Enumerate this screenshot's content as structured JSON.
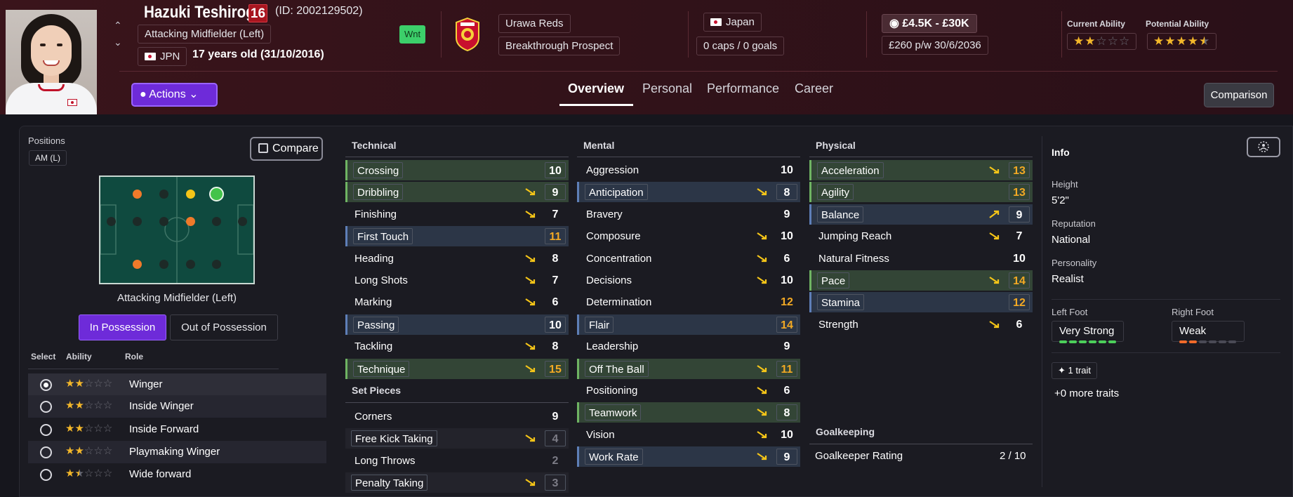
{
  "colors": {
    "accent": "#6e2bd9",
    "orange": "#f3a924",
    "green": "#6fb463",
    "blue": "#5e7fb8",
    "star": "#f3b72a",
    "star_empty": "#6b6b74"
  },
  "header": {
    "name": "Hazuki Teshirogi",
    "squad_number": "16",
    "id_text": "(ID: 2002129502)",
    "position": "Attacking Midfielder (Left)",
    "nationality_code": "JPN",
    "age_text": "17 years old (31/10/2016)",
    "wnt_badge": "Wnt",
    "club": "Urawa Reds",
    "status": "Breakthrough Prospect",
    "country": "Japan",
    "caps": "0 caps / 0 goals",
    "value": "£4.5K - £30K",
    "wage": "£260 p/w 30/6/2036",
    "current_ability_label": "Current Ability",
    "potential_ability_label": "Potential Ability",
    "current_ability_stars": 2,
    "potential_ability_stars": 4.5
  },
  "toolbar": {
    "actions_label": "Actions",
    "comparison_label": "Comparison"
  },
  "tabs": [
    {
      "label": "Overview",
      "active": true
    },
    {
      "label": "Personal"
    },
    {
      "label": "Performance"
    },
    {
      "label": "Career"
    }
  ],
  "left": {
    "positions_label": "Positions",
    "position_tag": "AM (L)",
    "compare_label": "Compare",
    "position_name": "Attacking Midfielder (Left)",
    "in_possession": "In Possession",
    "out_of_possession": "Out of Possession",
    "headers": {
      "select": "Select",
      "ability": "Ability",
      "role": "Role"
    },
    "roles": [
      {
        "name": "Winger",
        "stars": 2,
        "selected": true
      },
      {
        "name": "Inside Winger",
        "stars": 2
      },
      {
        "name": "Inside Forward",
        "stars": 2
      },
      {
        "name": "Playmaking Winger",
        "stars": 2
      },
      {
        "name": "Wide forward",
        "stars": 1.5
      }
    ]
  },
  "technical": {
    "title": "Technical",
    "attrs": [
      {
        "name": "Crossing",
        "value": "10",
        "hl": "green"
      },
      {
        "name": "Dribbling",
        "value": "9",
        "hl": "green",
        "trend": "down"
      },
      {
        "name": "Finishing",
        "value": "7",
        "trend": "down"
      },
      {
        "name": "First Touch",
        "value": "11",
        "hl": "blue",
        "color": "orange"
      },
      {
        "name": "Heading",
        "value": "8",
        "trend": "down"
      },
      {
        "name": "Long Shots",
        "value": "7",
        "trend": "down"
      },
      {
        "name": "Marking",
        "value": "6",
        "trend": "down"
      },
      {
        "name": "Passing",
        "value": "10",
        "hl": "blue"
      },
      {
        "name": "Tackling",
        "value": "8",
        "trend": "down"
      },
      {
        "name": "Technique",
        "value": "15",
        "hl": "green",
        "trend": "down",
        "color": "orange"
      }
    ]
  },
  "set_pieces": {
    "title": "Set Pieces",
    "attrs": [
      {
        "name": "Corners",
        "value": "9"
      },
      {
        "name": "Free Kick Taking",
        "value": "4",
        "hl": "grey",
        "trend": "down",
        "color": "dim"
      },
      {
        "name": "Long Throws",
        "value": "2",
        "color": "dim"
      },
      {
        "name": "Penalty Taking",
        "value": "3",
        "hl": "grey",
        "trend": "down",
        "color": "dim"
      }
    ]
  },
  "mental": {
    "title": "Mental",
    "attrs": [
      {
        "name": "Aggression",
        "value": "10"
      },
      {
        "name": "Anticipation",
        "value": "8",
        "hl": "blue",
        "trend": "down"
      },
      {
        "name": "Bravery",
        "value": "9"
      },
      {
        "name": "Composure",
        "value": "10",
        "trend": "down"
      },
      {
        "name": "Concentration",
        "value": "6",
        "trend": "down"
      },
      {
        "name": "Decisions",
        "value": "10",
        "trend": "down"
      },
      {
        "name": "Determination",
        "value": "12",
        "color": "orange"
      },
      {
        "name": "Flair",
        "value": "14",
        "hl": "blue",
        "color": "orange"
      },
      {
        "name": "Leadership",
        "value": "9"
      },
      {
        "name": "Off The Ball",
        "value": "11",
        "hl": "green",
        "trend": "down",
        "color": "orange"
      },
      {
        "name": "Positioning",
        "value": "6",
        "trend": "down"
      },
      {
        "name": "Teamwork",
        "value": "8",
        "hl": "green",
        "trend": "down"
      },
      {
        "name": "Vision",
        "value": "10",
        "trend": "down"
      },
      {
        "name": "Work Rate",
        "value": "9",
        "hl": "blue",
        "trend": "down"
      }
    ]
  },
  "physical": {
    "title": "Physical",
    "attrs": [
      {
        "name": "Acceleration",
        "value": "13",
        "hl": "green",
        "trend": "down",
        "color": "orange"
      },
      {
        "name": "Agility",
        "value": "13",
        "hl": "green",
        "color": "orange"
      },
      {
        "name": "Balance",
        "value": "9",
        "hl": "blue",
        "trend": "up"
      },
      {
        "name": "Jumping Reach",
        "value": "7",
        "trend": "down"
      },
      {
        "name": "Natural Fitness",
        "value": "10"
      },
      {
        "name": "Pace",
        "value": "14",
        "hl": "green",
        "trend": "down",
        "color": "orange"
      },
      {
        "name": "Stamina",
        "value": "12",
        "hl": "blue",
        "color": "orange"
      },
      {
        "name": "Strength",
        "value": "6",
        "trend": "down"
      }
    ]
  },
  "goalkeeping": {
    "title": "Goalkeeping",
    "rating_label": "Goalkeeper Rating",
    "rating_value": "2 / 10"
  },
  "info": {
    "title": "Info",
    "height_label": "Height",
    "height": "5'2\"",
    "reputation_label": "Reputation",
    "reputation": "National",
    "personality_label": "Personality",
    "personality": "Realist",
    "left_foot_label": "Left Foot",
    "left_foot": "Very Strong",
    "left_foot_level": 6,
    "right_foot_label": "Right Foot",
    "right_foot": "Weak",
    "right_foot_level": 2,
    "traits": "1 trait",
    "more_traits": "+0 more traits"
  }
}
